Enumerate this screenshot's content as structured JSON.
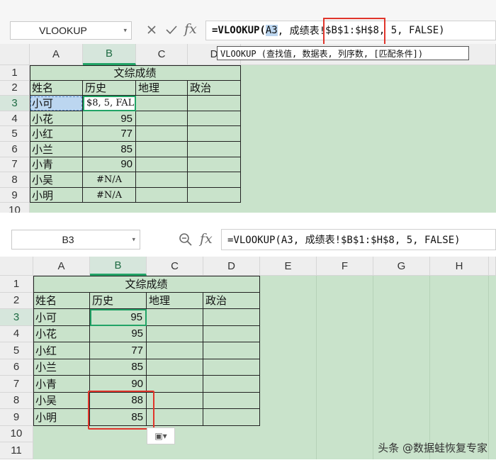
{
  "top": {
    "name_box": "VLOOKUP",
    "cancel_icon": "close-icon",
    "confirm_icon": "check-icon",
    "fx_label": "fx",
    "formula_prefix": "=VLOOKUP(",
    "formula_arg1": "A3",
    "formula_mid": ", 成绩表!",
    "formula_range": "$B$1:$H$8",
    "formula_suffix": ", 5, FALSE)",
    "tooltip": "VLOOKUP (查找值, 数据表, 列序数, [匹配条件])",
    "col_headers": [
      "A",
      "B",
      "C",
      "D"
    ],
    "row_headers": [
      "1",
      "2",
      "3",
      "4",
      "5",
      "6",
      "7",
      "8",
      "9",
      "10"
    ],
    "title": "文综成绩",
    "headers": [
      "姓名",
      "历史",
      "地理",
      "政治"
    ],
    "rows": [
      {
        "name": "小可",
        "value": "$8, 5, FAL"
      },
      {
        "name": "小花",
        "value": "95"
      },
      {
        "name": "小红",
        "value": "77"
      },
      {
        "name": "小兰",
        "value": "85"
      },
      {
        "name": "小青",
        "value": "90"
      },
      {
        "name": "小吴",
        "value": "#N/A"
      },
      {
        "name": "小明",
        "value": "#N/A"
      }
    ]
  },
  "bottom": {
    "name_box": "B3",
    "zoom_icon": "zoom-icon",
    "fx_label": "fx",
    "formula": "=VLOOKUP(A3, 成绩表!$B$1:$H$8, 5, FALSE)",
    "col_headers": [
      "A",
      "B",
      "C",
      "D",
      "E",
      "F",
      "G",
      "H"
    ],
    "row_headers": [
      "1",
      "2",
      "3",
      "4",
      "5",
      "6",
      "7",
      "8",
      "9",
      "10",
      "11"
    ],
    "title": "文综成绩",
    "headers": [
      "姓名",
      "历史",
      "地理",
      "政治"
    ],
    "rows": [
      {
        "name": "小可",
        "value": "95"
      },
      {
        "name": "小花",
        "value": "95"
      },
      {
        "name": "小红",
        "value": "77"
      },
      {
        "name": "小兰",
        "value": "85"
      },
      {
        "name": "小青",
        "value": "90"
      },
      {
        "name": "小吴",
        "value": "88"
      },
      {
        "name": "小明",
        "value": "85"
      }
    ]
  },
  "watermark": "头条 @数据蛙恢复专家",
  "colors": {
    "cell_green": "#c9e3cb",
    "selection_green": "#21a366",
    "highlight_red": "#e0352b"
  }
}
